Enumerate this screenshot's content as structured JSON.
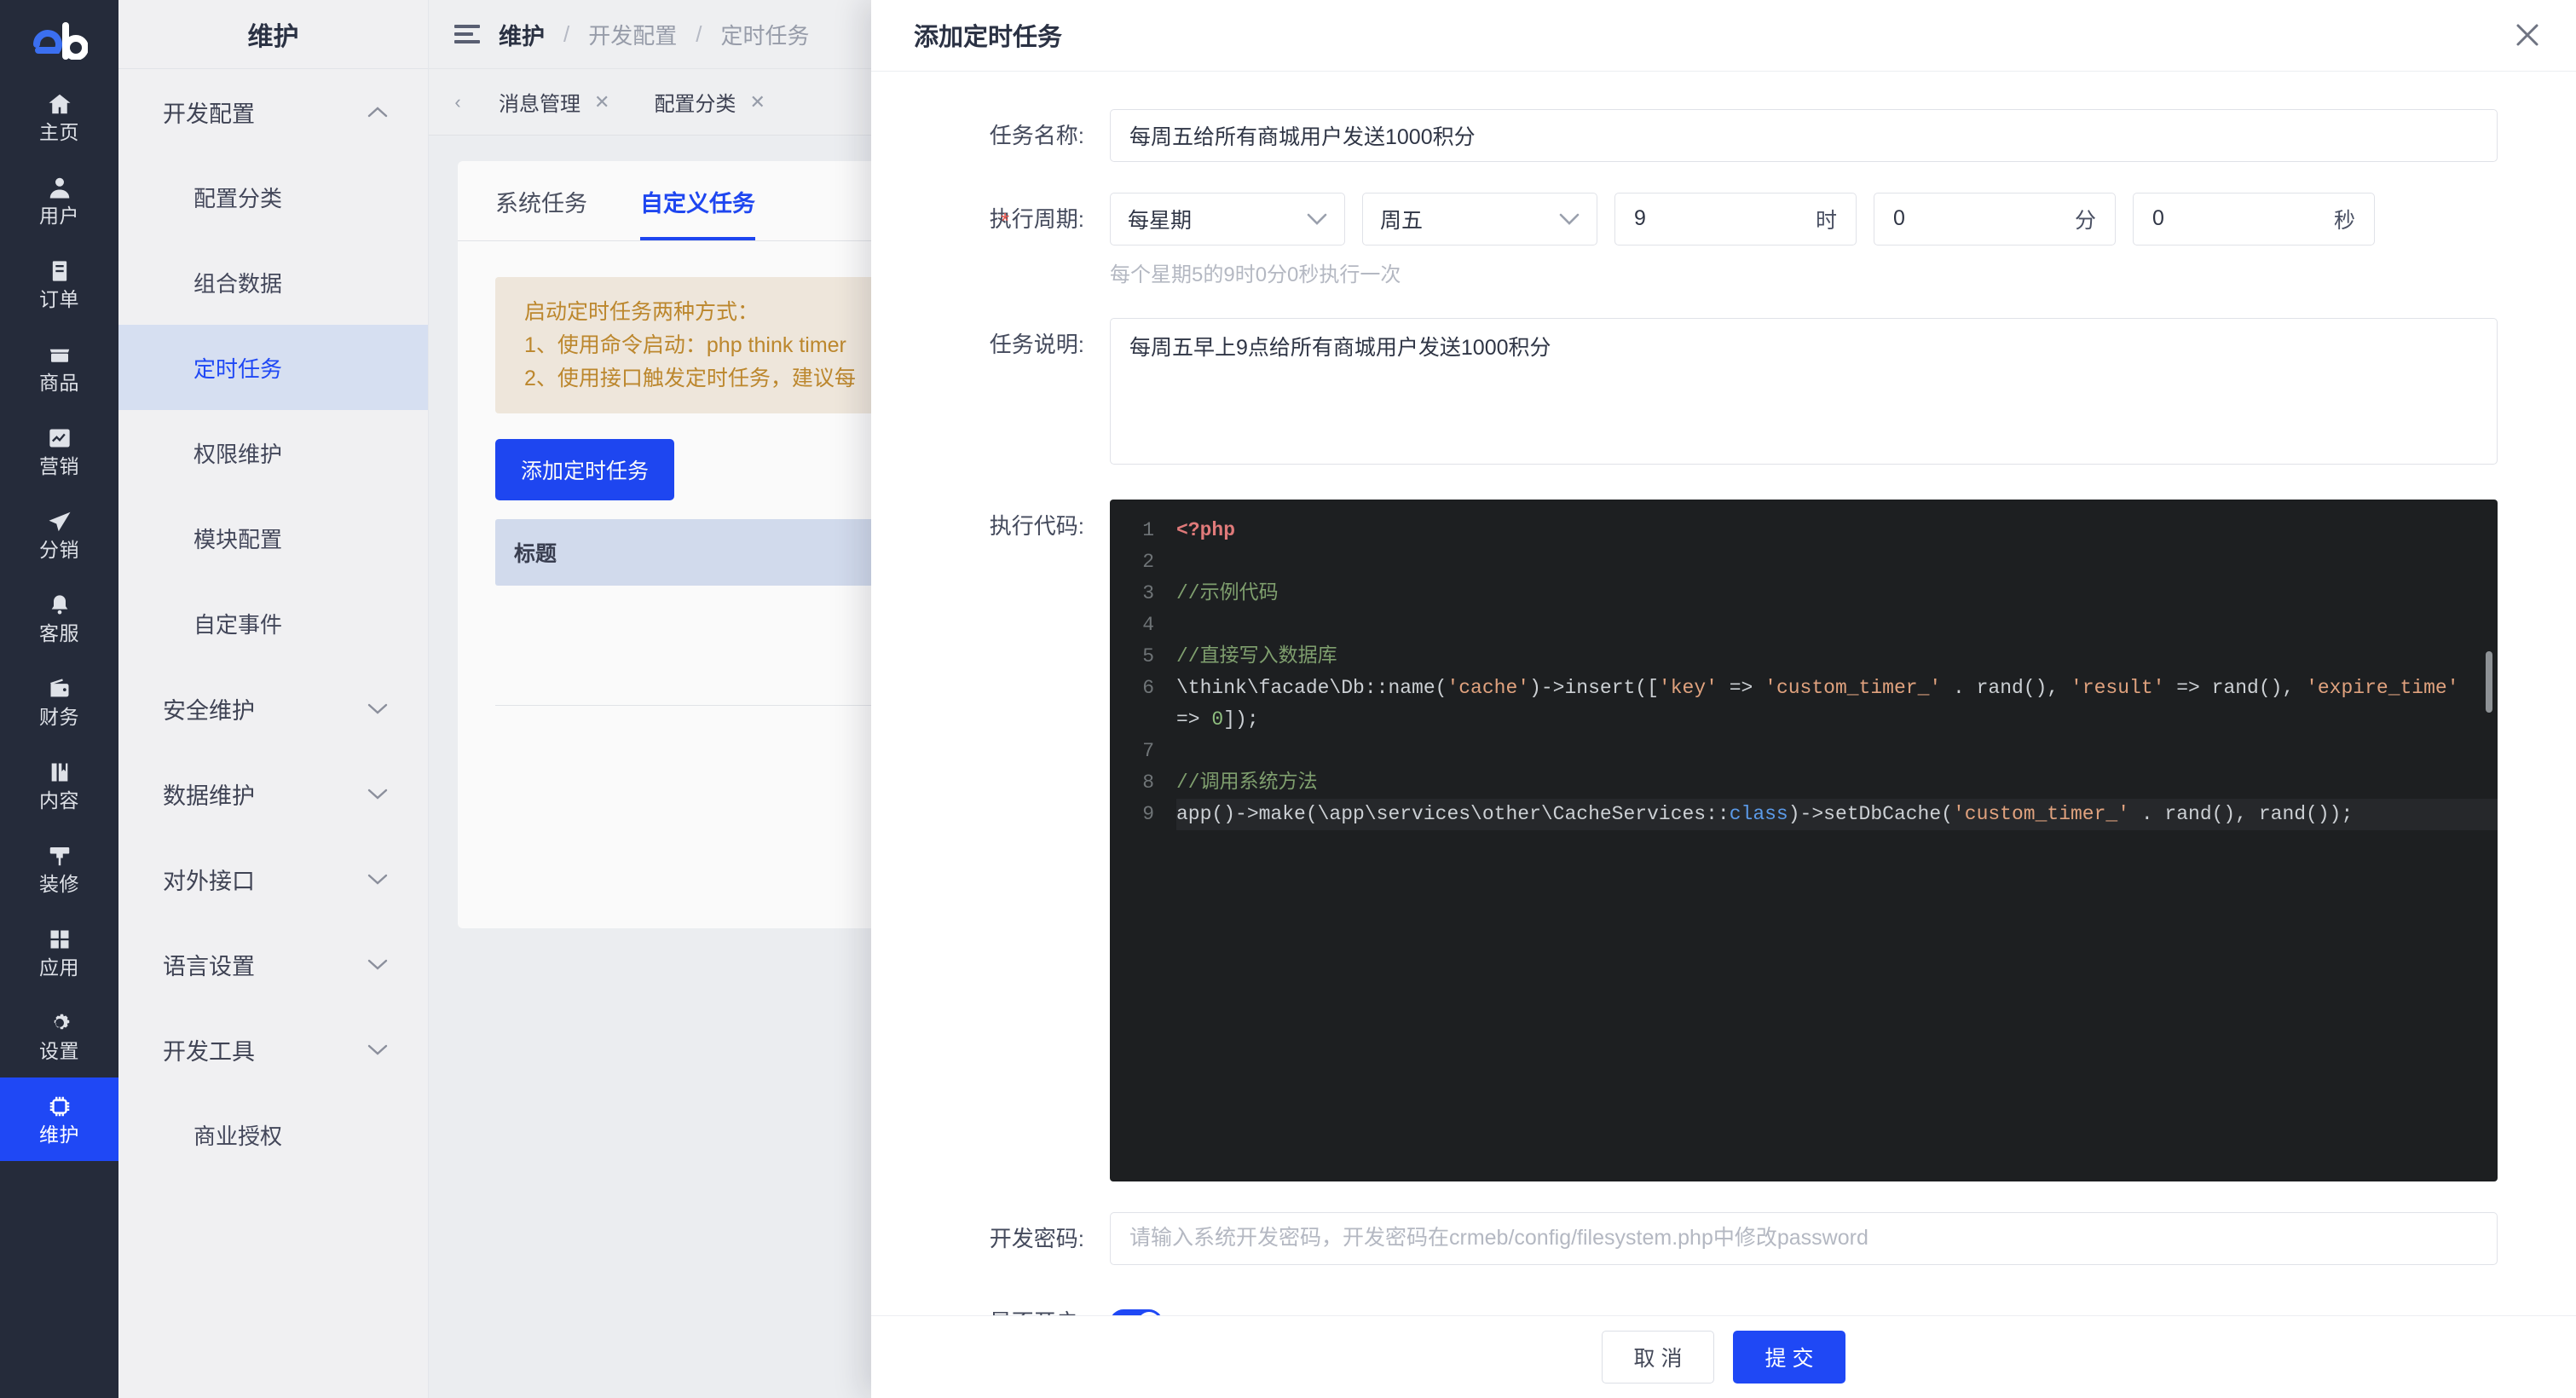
{
  "brand": {
    "logo_text": "eb"
  },
  "icon_rail": {
    "items": [
      {
        "label": "主页",
        "icon": "home-icon",
        "active": false
      },
      {
        "label": "用户",
        "icon": "user-icon",
        "active": false
      },
      {
        "label": "订单",
        "icon": "order-icon",
        "active": false
      },
      {
        "label": "商品",
        "icon": "shop-icon",
        "active": false
      },
      {
        "label": "营销",
        "icon": "chart-icon",
        "active": false
      },
      {
        "label": "分销",
        "icon": "send-icon",
        "active": false
      },
      {
        "label": "客服",
        "icon": "bell-icon",
        "active": false
      },
      {
        "label": "财务",
        "icon": "wallet-icon",
        "active": false
      },
      {
        "label": "内容",
        "icon": "book-icon",
        "active": false
      },
      {
        "label": "装修",
        "icon": "brush-icon",
        "active": false
      },
      {
        "label": "应用",
        "icon": "grid-icon",
        "active": false
      },
      {
        "label": "设置",
        "icon": "gear-icon",
        "active": false
      },
      {
        "label": "维护",
        "icon": "chip-icon",
        "active": true
      }
    ]
  },
  "sub_menu": {
    "title": "维护",
    "entries": [
      {
        "label": "开发配置",
        "type": "group",
        "expanded": true
      },
      {
        "label": "配置分类",
        "type": "item",
        "active": false
      },
      {
        "label": "组合数据",
        "type": "item",
        "active": false
      },
      {
        "label": "定时任务",
        "type": "item",
        "active": true
      },
      {
        "label": "权限维护",
        "type": "item",
        "active": false
      },
      {
        "label": "模块配置",
        "type": "item",
        "active": false
      },
      {
        "label": "自定事件",
        "type": "item",
        "active": false
      },
      {
        "label": "安全维护",
        "type": "group",
        "expanded": false
      },
      {
        "label": "数据维护",
        "type": "group",
        "expanded": false
      },
      {
        "label": "对外接口",
        "type": "group",
        "expanded": false
      },
      {
        "label": "语言设置",
        "type": "group",
        "expanded": false
      },
      {
        "label": "开发工具",
        "type": "group",
        "expanded": false
      },
      {
        "label": "商业授权",
        "type": "item",
        "active": false
      }
    ]
  },
  "topbar": {
    "menu_icon": "hamburger-icon",
    "breadcrumb": [
      "维护",
      "开发配置",
      "定时任务"
    ],
    "separator": "/"
  },
  "page_tabs": {
    "prev_arrow": "‹",
    "tabs": [
      {
        "label": "消息管理",
        "close": "✕"
      },
      {
        "label": "配置分类",
        "close": "✕"
      }
    ]
  },
  "content": {
    "tabs": [
      {
        "label": "系统任务",
        "active": false
      },
      {
        "label": "自定义任务",
        "active": true
      }
    ],
    "notice_lines": [
      "启动定时任务两种方式：",
      "1、使用命令启动：php think timer",
      "2、使用接口触发定时任务，建议每"
    ],
    "add_button": "添加定时任务",
    "table_header": "标题"
  },
  "modal": {
    "title": "添加定时任务",
    "close_icon": "close-icon",
    "fields": {
      "task_name": {
        "label": "任务名称:",
        "value": "每周五给所有商城用户发送1000积分",
        "placeholder": ""
      },
      "cycle": {
        "label": "执行周期:",
        "required": true,
        "required_mark": "*",
        "period": "每星期",
        "weekday": "周五",
        "hour": "9",
        "hour_unit": "时",
        "minute": "0",
        "minute_unit": "分",
        "second": "0",
        "second_unit": "秒",
        "hint": "每个星期5的9时0分0秒执行一次"
      },
      "description": {
        "label": "任务说明:",
        "value": "每周五早上9点给所有商城用户发送1000积分"
      },
      "code": {
        "label": "执行代码:",
        "lines": [
          {
            "n": "1",
            "tokens": [
              {
                "t": "tag",
                "s": "<?php"
              }
            ]
          },
          {
            "n": "2",
            "tokens": []
          },
          {
            "n": "3",
            "tokens": [
              {
                "t": "com",
                "s": "//示例代码"
              }
            ]
          },
          {
            "n": "4",
            "tokens": []
          },
          {
            "n": "5",
            "tokens": [
              {
                "t": "com",
                "s": "//直接写入数据库"
              }
            ]
          },
          {
            "n": "6",
            "tokens": [
              {
                "t": "txt",
                "s": "\\think\\facade\\Db::name("
              },
              {
                "t": "str",
                "s": "'cache'"
              },
              {
                "t": "txt",
                "s": ")->insert(["
              },
              {
                "t": "str",
                "s": "'key'"
              },
              {
                "t": "txt",
                "s": " => "
              },
              {
                "t": "str",
                "s": "'custom_timer_'"
              },
              {
                "t": "txt",
                "s": " . rand(), "
              },
              {
                "t": "str",
                "s": "'result'"
              },
              {
                "t": "txt",
                "s": " => rand(), "
              },
              {
                "t": "str",
                "s": "'expire_time'"
              },
              {
                "t": "txt",
                "s": " => "
              },
              {
                "t": "num",
                "s": "0"
              },
              {
                "t": "txt",
                "s": "]);"
              }
            ]
          },
          {
            "n": "7",
            "tokens": []
          },
          {
            "n": "8",
            "tokens": [
              {
                "t": "com",
                "s": "//调用系统方法"
              }
            ]
          },
          {
            "n": "9",
            "highlight": true,
            "tokens": [
              {
                "t": "txt",
                "s": "app()->make(\\app\\services\\other\\CacheServices::"
              },
              {
                "t": "kw",
                "s": "class"
              },
              {
                "t": "txt",
                "s": ")->setDbCache("
              },
              {
                "t": "str",
                "s": "'custom_timer_'"
              },
              {
                "t": "txt",
                "s": " . rand(), rand());"
              }
            ]
          }
        ]
      },
      "dev_password": {
        "label": "开发密码:",
        "value": "",
        "placeholder": "请输入系统开发密码，开发密码在crmeb/config/filesystem.php中修改password"
      },
      "enabled": {
        "label": "是否开启:",
        "on": true
      }
    },
    "footer": {
      "cancel": "取 消",
      "submit": "提 交"
    }
  },
  "colors": {
    "accent": "#1f48f5",
    "rail_bg": "#252b3a",
    "menu_bg": "#f0f0f2",
    "active_item_bg": "#d6dff1",
    "notice_bg": "#f3ebe0",
    "notice_text": "#c08a2e",
    "code_bg": "#1d1f21"
  }
}
